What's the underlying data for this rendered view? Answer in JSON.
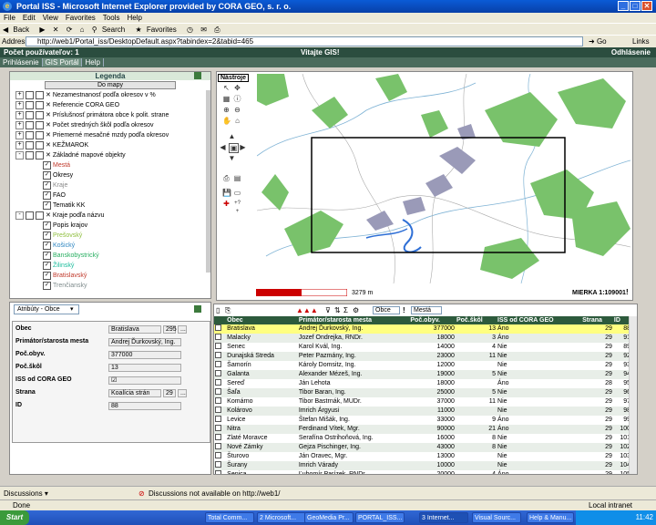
{
  "window": {
    "title": "Portal ISS - Microsoft Internet Explorer provided by CORA GEO, s. r. o.",
    "menu": [
      "File",
      "Edit",
      "View",
      "Favorites",
      "Tools",
      "Help"
    ],
    "toolbar": {
      "back": "Back",
      "search": "Search",
      "favorites": "Favorites"
    },
    "address_label": "Address",
    "address_value": "http://web1/Portal_iss/DesktopDefault.aspx?tabindex=2&tabid=465",
    "go_label": "Go",
    "links_label": "Links"
  },
  "app": {
    "users_count_label": "Počet používateľov: 1",
    "welcome": "Vitajte GIS!",
    "logout": "Odhlásenie",
    "nav": [
      "Prihlásenie",
      "GIS Portál",
      "Help"
    ]
  },
  "legend": {
    "title": "Legenda",
    "to_map_button": "Do mapy",
    "items": [
      {
        "label": "Nezamestnanosť podľa okresov v %",
        "indent": 0,
        "expand": "+"
      },
      {
        "label": "Referencie CORA GEO",
        "indent": 0,
        "expand": "+"
      },
      {
        "label": "Príslušnosť primátora obce k polit. strane",
        "indent": 0,
        "expand": "+"
      },
      {
        "label": "Počet stredných škôl podľa okresov",
        "indent": 0,
        "expand": "+"
      },
      {
        "label": "Priemerné mesačné mzdy podľa okresov",
        "indent": 0,
        "expand": "+"
      },
      {
        "label": "KEŽMAROK",
        "indent": 0,
        "expand": "+"
      },
      {
        "label": "Základné mapové objekty",
        "indent": 0,
        "expand": "-"
      },
      {
        "label": "Mestá",
        "indent": 1,
        "color": "#c0392b"
      },
      {
        "label": "Okresy",
        "indent": 1,
        "color": "#000000"
      },
      {
        "label": "Kraje",
        "indent": 1,
        "color": "#888888"
      },
      {
        "label": "FAO",
        "indent": 1,
        "color": "#000000"
      },
      {
        "label": "Tematik KK",
        "indent": 1,
        "color": "#000000"
      },
      {
        "label": "Kraje podľa názvu",
        "indent": 0,
        "expand": "-"
      },
      {
        "label": "Popis krajov",
        "indent": 1,
        "color": "#000000"
      },
      {
        "label": "Prešovský",
        "indent": 1,
        "color": "#8fbf3f"
      },
      {
        "label": "Košický",
        "indent": 1,
        "color": "#2e86c1"
      },
      {
        "label": "Banskobystrický",
        "indent": 1,
        "color": "#27ae60"
      },
      {
        "label": "Žilinský",
        "indent": 1,
        "color": "#1abc9c"
      },
      {
        "label": "Bratislavský",
        "indent": 1,
        "color": "#c0392b"
      },
      {
        "label": "Trenčiansky",
        "indent": 1,
        "color": "#7f8c8d"
      }
    ]
  },
  "map": {
    "tools_title": "Nástroje",
    "scale_text": "3279 m",
    "scale_ratio": "MIERKA 1:109001"
  },
  "attributes": {
    "select_value": "Atribúty - Obce",
    "fields": [
      {
        "label": "Obec",
        "value": "Bratislava",
        "extra": "295"
      },
      {
        "label": "Primátor/starosta mesta",
        "value": "Andrej Ďurkovský, Ing."
      },
      {
        "label": "Poč.obyv.",
        "value": "377000"
      },
      {
        "label": "Poč.škôl",
        "value": "13"
      },
      {
        "label": "ISS od CORA GEO",
        "value": "☑"
      },
      {
        "label": "Strana",
        "value": "Koalícia strán",
        "extra": "29"
      },
      {
        "label": "ID",
        "value": "88"
      }
    ]
  },
  "table": {
    "toolbar_select1": "Obce",
    "toolbar_select2": "Mestá",
    "columns": [
      "Obec",
      "Primátor/starosta mesta",
      "Poč.obyv.",
      "Poč.škôl",
      "ISS od CORA GEO",
      "Strana",
      "ID"
    ],
    "rows": [
      [
        "Bratislava",
        "Andrej Ďurkovský, Ing.",
        "377000",
        "13",
        "Áno",
        "29",
        "88"
      ],
      [
        "Malacky",
        "Jozef Ondrejka, RNDr.",
        "18000",
        "3",
        "Áno",
        "29",
        "91"
      ],
      [
        "Senec",
        "Karol Kvál, Ing.",
        "14000",
        "4",
        "Nie",
        "29",
        "89"
      ],
      [
        "Dunajská Streda",
        "Peter Pazmány, Ing.",
        "23000",
        "11",
        "Nie",
        "29",
        "92"
      ],
      [
        "Šamorín",
        "Károly Domsitz, Ing.",
        "12000",
        "",
        "Nie",
        "29",
        "93"
      ],
      [
        "Galanta",
        "Alexander Mézeš, Ing.",
        "19000",
        "5",
        "Nie",
        "29",
        "94"
      ],
      [
        "Sereď",
        "Ján Lehota",
        "18000",
        "",
        "Áno",
        "28",
        "95"
      ],
      [
        "Šaľa",
        "Tibor Baran, Ing.",
        "25000",
        "5",
        "Nie",
        "29",
        "96"
      ],
      [
        "Komárno",
        "Tibor Bastrnák, MUDr.",
        "37000",
        "11",
        "Nie",
        "29",
        "97"
      ],
      [
        "Kolárovo",
        "Imrich Árgyusi",
        "11000",
        "",
        "Nie",
        "29",
        "98"
      ],
      [
        "Levice",
        "Štefan Mišák, Ing.",
        "33000",
        "9",
        "Áno",
        "29",
        "99"
      ],
      [
        "Nitra",
        "Ferdinand Vítek, Mgr.",
        "90000",
        "21",
        "Áno",
        "29",
        "100"
      ],
      [
        "Zlaté Moravce",
        "Serafína Ostrihoňová, Ing.",
        "16000",
        "8",
        "Nie",
        "29",
        "101"
      ],
      [
        "Nové Zámky",
        "Gejza Pischinger, Ing.",
        "43000",
        "8",
        "Nie",
        "29",
        "102"
      ],
      [
        "Šturovo",
        "Ján Oravec, Mgr.",
        "13000",
        "",
        "Nie",
        "29",
        "103"
      ],
      [
        "Šurany",
        "Imrich Várady",
        "10000",
        "",
        "Nie",
        "29",
        "104"
      ],
      [
        "Senica",
        "Ľubomír Parízek, RNDr.",
        "20000",
        "4",
        "Áno",
        "29",
        "105"
      ],
      [
        "Holíč",
        "Vladimír Herák, Ing.",
        "11000",
        "",
        "Nie",
        "29",
        "106"
      ],
      [
        "Myjava",
        "Pavol Halabrín",
        "13000",
        "5",
        "Nie",
        "29",
        "107"
      ],
      [
        "Skalica",
        "Stanislav Chovanec, Ing.",
        "15000",
        "",
        "Nie",
        "29",
        "108"
      ]
    ]
  },
  "browser_status": {
    "discussions": "Discussions ▾",
    "discussions_msg": "Discussions not available on http://web1/",
    "status": "Done",
    "zone": "Local intranet"
  },
  "taskbar": {
    "start": "Start",
    "tasks": [
      "Total Comm...",
      "2 Microsoft...",
      "GeoMedia Pr...",
      "PORTAL_ISS...",
      "3 Internet...",
      "Visual Sourc...",
      "Help & Manu..."
    ],
    "clock": "11:42"
  }
}
